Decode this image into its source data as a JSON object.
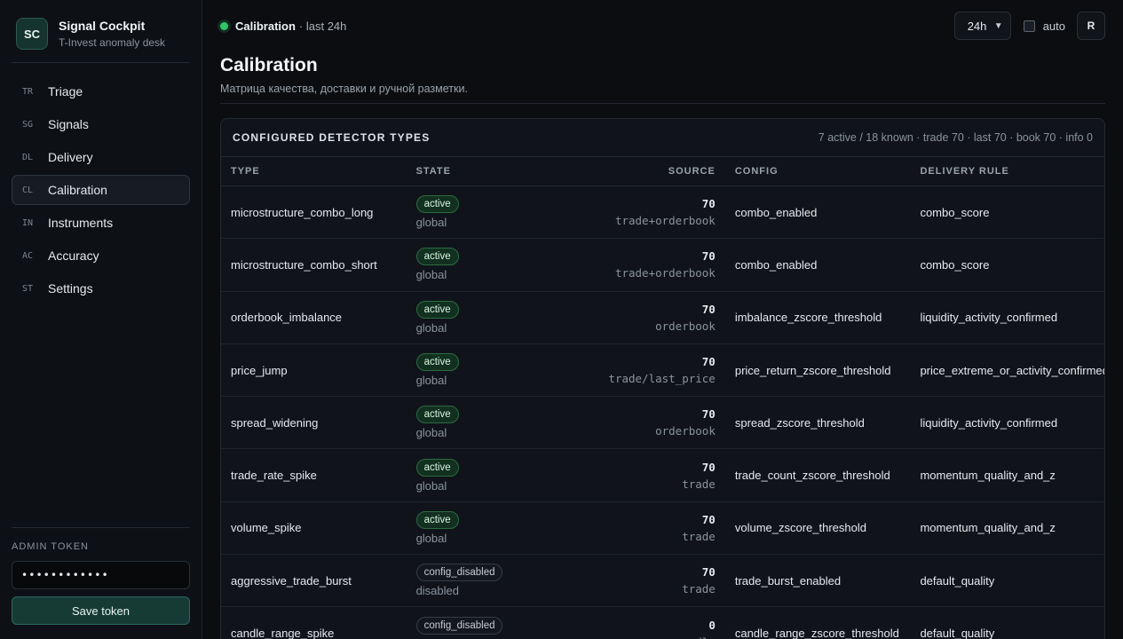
{
  "brand": {
    "logo": "SC",
    "title": "Signal Cockpit",
    "subtitle": "T-Invest anomaly desk"
  },
  "nav": [
    {
      "abbr": "TR",
      "label": "Triage",
      "active": false
    },
    {
      "abbr": "SG",
      "label": "Signals",
      "active": false
    },
    {
      "abbr": "DL",
      "label": "Delivery",
      "active": false
    },
    {
      "abbr": "CL",
      "label": "Calibration",
      "active": true
    },
    {
      "abbr": "IN",
      "label": "Instruments",
      "active": false
    },
    {
      "abbr": "AC",
      "label": "Accuracy",
      "active": false
    },
    {
      "abbr": "ST",
      "label": "Settings",
      "active": false
    }
  ],
  "admin": {
    "label": "ADMIN TOKEN",
    "token_value": "••••••••••••",
    "save_label": "Save token"
  },
  "status": {
    "page": "Calibration",
    "range": "· last 24h",
    "dot_color": "#33c46b"
  },
  "toolbar": {
    "range_value": "24h",
    "auto_label": "auto",
    "auto_checked": false,
    "refresh_label": "R"
  },
  "page": {
    "title": "Calibration",
    "subtitle": "Матрица качества, доставки и ручной разметки."
  },
  "card": {
    "title": "CONFIGURED DETECTOR TYPES",
    "meta": "7 active / 18 known · trade 70 · last 70 · book 70 · info 0",
    "columns": {
      "type": "TYPE",
      "state": "STATE",
      "source": "SOURCE",
      "config": "CONFIG",
      "rule": "DELIVERY RULE"
    },
    "rows": [
      {
        "type": "microstructure_combo_long",
        "state": "active",
        "scope": "global",
        "count": "70",
        "source": "trade+orderbook",
        "config": "combo_enabled",
        "rule": "combo_score"
      },
      {
        "type": "microstructure_combo_short",
        "state": "active",
        "scope": "global",
        "count": "70",
        "source": "trade+orderbook",
        "config": "combo_enabled",
        "rule": "combo_score"
      },
      {
        "type": "orderbook_imbalance",
        "state": "active",
        "scope": "global",
        "count": "70",
        "source": "orderbook",
        "config": "imbalance_zscore_threshold",
        "rule": "liquidity_activity_confirmed"
      },
      {
        "type": "price_jump",
        "state": "active",
        "scope": "global",
        "count": "70",
        "source": "trade/last_price",
        "config": "price_return_zscore_threshold",
        "rule": "price_extreme_or_activity_confirmed"
      },
      {
        "type": "spread_widening",
        "state": "active",
        "scope": "global",
        "count": "70",
        "source": "orderbook",
        "config": "spread_zscore_threshold",
        "rule": "liquidity_activity_confirmed"
      },
      {
        "type": "trade_rate_spike",
        "state": "active",
        "scope": "global",
        "count": "70",
        "source": "trade",
        "config": "trade_count_zscore_threshold",
        "rule": "momentum_quality_and_z"
      },
      {
        "type": "volume_spike",
        "state": "active",
        "scope": "global",
        "count": "70",
        "source": "trade",
        "config": "volume_zscore_threshold",
        "rule": "momentum_quality_and_z"
      },
      {
        "type": "aggressive_trade_burst",
        "state": "config_disabled",
        "scope": "disabled",
        "count": "70",
        "source": "trade",
        "config": "trade_burst_enabled",
        "rule": "default_quality"
      },
      {
        "type": "candle_range_spike",
        "state": "config_disabled",
        "scope": "disabled",
        "count": "0",
        "source": "candle",
        "config": "candle_range_zscore_threshold",
        "rule": "default_quality"
      }
    ]
  }
}
